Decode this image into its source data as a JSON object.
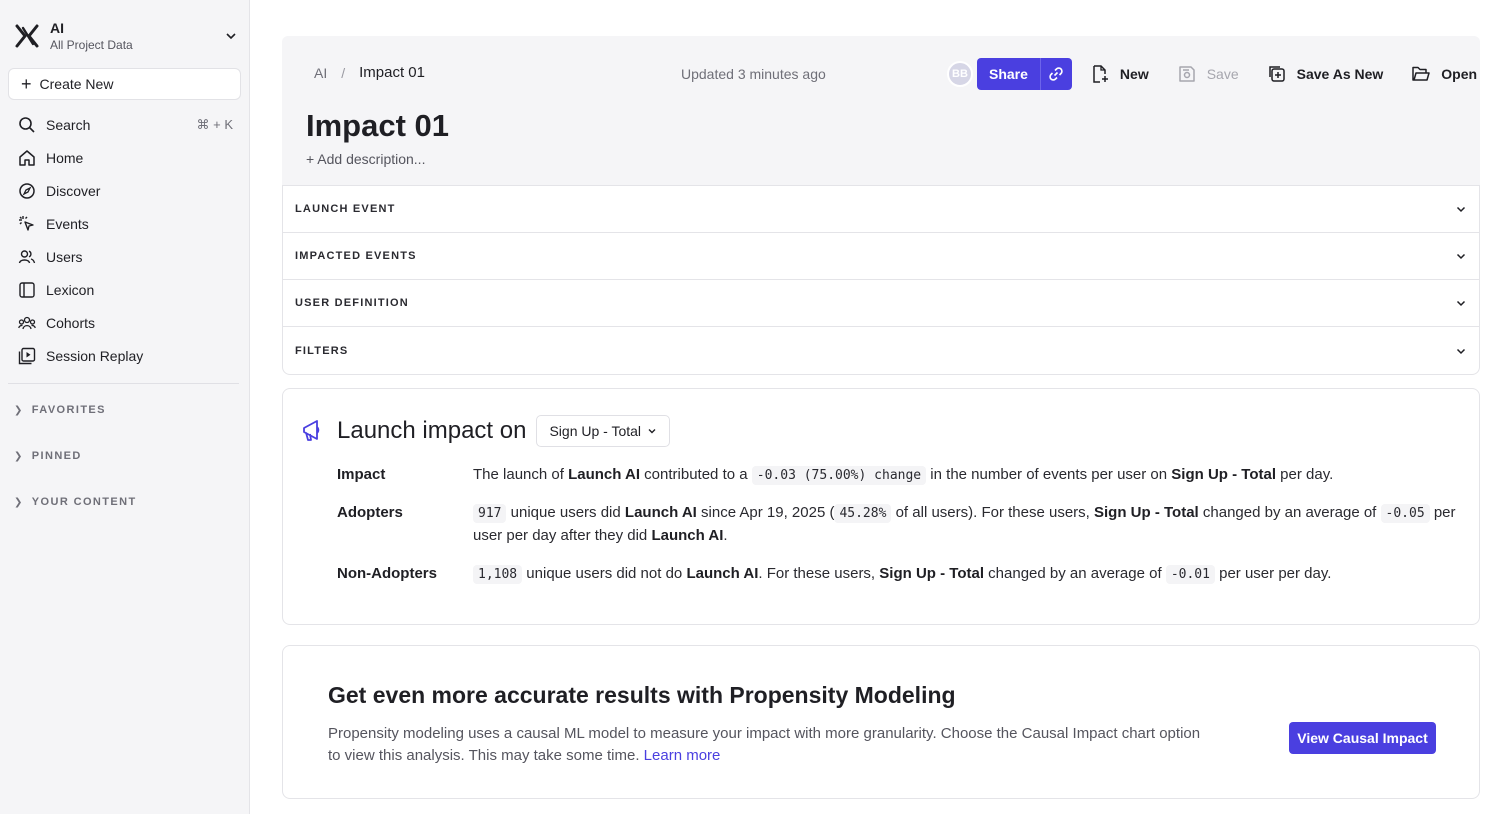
{
  "sidebar": {
    "project_name": "AI",
    "project_sub": "All Project Data",
    "create_new": "Create New",
    "items": [
      {
        "label": "Search",
        "shortcut": "⌘ + K"
      },
      {
        "label": "Home"
      },
      {
        "label": "Discover"
      },
      {
        "label": "Events"
      },
      {
        "label": "Users"
      },
      {
        "label": "Lexicon"
      },
      {
        "label": "Cohorts"
      },
      {
        "label": "Session Replay"
      }
    ],
    "sections": [
      "FAVORITES",
      "PINNED",
      "YOUR CONTENT"
    ]
  },
  "header": {
    "breadcrumb_root": "AI",
    "breadcrumb_sep": "/",
    "breadcrumb_current": "Impact 01",
    "updated": "Updated 3 minutes ago",
    "title": "Impact 01",
    "add_description": "+ Add description...",
    "avatar_initials": "BB",
    "share": "Share",
    "new": "New",
    "save": "Save",
    "save_as_new": "Save As New",
    "open": "Open"
  },
  "accordions": [
    "LAUNCH EVENT",
    "IMPACTED EVENTS",
    "USER DEFINITION",
    "FILTERS"
  ],
  "impact": {
    "title": "Launch impact on",
    "metric": "Sign Up - Total",
    "rows": {
      "impact_label": "Impact",
      "impact_t1": "The launch of ",
      "impact_b1": "Launch AI",
      "impact_t2": " contributed to a ",
      "impact_code": "-0.03 (75.00%) change",
      "impact_t3": " in the number of events per user on ",
      "impact_b2": "Sign Up - Total",
      "impact_t4": " per day.",
      "adopters_label": "Adopters",
      "adopters_code1": "917",
      "adopters_t1": " unique users did ",
      "adopters_b1": "Launch AI",
      "adopters_t2": " since Apr 19, 2025 (",
      "adopters_code2": "45.28%",
      "adopters_t3": " of all users). For these users, ",
      "adopters_b2": "Sign Up - Total",
      "adopters_t4": " changed by an average of ",
      "adopters_code3": "-0.05",
      "adopters_t5": " per user per day after they did ",
      "adopters_b3": "Launch AI",
      "adopters_t6": ".",
      "non_label": "Non-Adopters",
      "non_code1": "1,108",
      "non_t1": " unique users did not do ",
      "non_b1": "Launch AI",
      "non_t2": ". For these users, ",
      "non_b2": "Sign Up - Total",
      "non_t3": " changed by an average of ",
      "non_code2": "-0.01",
      "non_t4": " per user per day."
    }
  },
  "propensity": {
    "title": "Get even more accurate results with Propensity Modeling",
    "text": "Propensity modeling uses a causal ML model to measure your impact with more granularity. Choose the Causal Impact chart option to view this analysis. This may take some time. ",
    "learn_more": "Learn more",
    "button": "View Causal Impact"
  },
  "colors": {
    "accent": "#4a3fe0",
    "sidebar_bg": "#f5f5f7"
  }
}
